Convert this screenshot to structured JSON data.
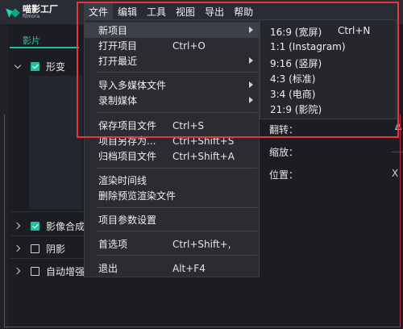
{
  "app": {
    "logo_cn": "喵影工厂",
    "logo_en": "filmora"
  },
  "menubar": [
    "文件",
    "编辑",
    "工具",
    "视图",
    "导出",
    "帮助"
  ],
  "left_panel": {
    "tab": "影片",
    "rows": [
      {
        "label": "形变",
        "checked": true,
        "expanded": true
      },
      {
        "label": "影像合成",
        "checked": true,
        "expanded": false
      },
      {
        "label": "阴影",
        "checked": false,
        "expanded": false
      },
      {
        "label": "自动增强",
        "checked": false,
        "expanded": false
      }
    ]
  },
  "right_props": {
    "flip_label": "翻转：",
    "scale_label": "缩放：",
    "position_label": "位置：",
    "position_x": "X",
    "flip_glyph": "Δ"
  },
  "file_menu": {
    "items": [
      {
        "label": "新项目",
        "shortcut": "",
        "submenu": true,
        "highlighted": true
      },
      {
        "label": "打开项目",
        "shortcut": "Ctrl+O",
        "submenu": false
      },
      {
        "label": "打开最近",
        "shortcut": "",
        "submenu": true
      },
      {
        "label": "导入多媒体文件",
        "shortcut": "",
        "submenu": true
      },
      {
        "label": "录制媒体",
        "shortcut": "",
        "submenu": true
      },
      {
        "label": "保存项目文件",
        "shortcut": "Ctrl+S",
        "submenu": false
      },
      {
        "label": "项目另存为...",
        "shortcut": "Ctrl+Shift+S",
        "submenu": false
      },
      {
        "label": "归档项目文件",
        "shortcut": "Ctrl+Shift+A",
        "submenu": false
      },
      {
        "label": "渲染时间线",
        "shortcut": "",
        "submenu": false
      },
      {
        "label": "删除预览渲染文件",
        "shortcut": "",
        "submenu": false
      },
      {
        "label": "项目参数设置",
        "shortcut": "",
        "submenu": false
      },
      {
        "label": "首选项",
        "shortcut": "Ctrl+Shift+,",
        "submenu": false
      },
      {
        "label": "退出",
        "shortcut": "Alt+F4",
        "submenu": false
      }
    ]
  },
  "new_project_submenu": {
    "items": [
      {
        "label": "16:9 (宽屏)",
        "shortcut": "Ctrl+N"
      },
      {
        "label": "1:1 (Instagram)",
        "shortcut": ""
      },
      {
        "label": "9:16 (竖屏)",
        "shortcut": ""
      },
      {
        "label": "4:3 (标准)",
        "shortcut": ""
      },
      {
        "label": "3:4 (电商)",
        "shortcut": ""
      },
      {
        "label": "21:9 (影院)",
        "shortcut": ""
      }
    ]
  },
  "colors": {
    "accent": "#1fbfa2",
    "highlight_box": "#e5383b",
    "menu_bg": "#2a2c32"
  }
}
